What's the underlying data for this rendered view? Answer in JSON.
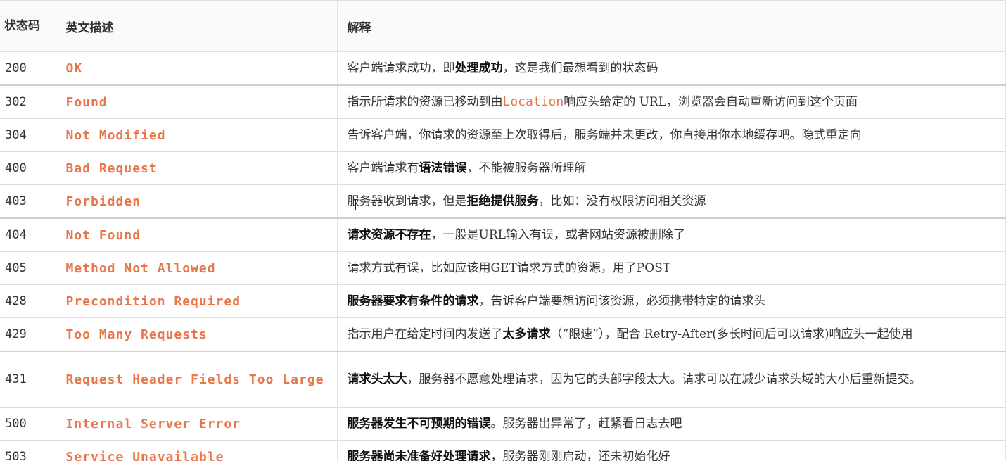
{
  "header": {
    "code": "状态码",
    "name": "英文描述",
    "desc": "解释"
  },
  "rows": [
    {
      "code": "200",
      "name": "OK",
      "desc": [
        {
          "t": "客户端请求成功，即",
          "s": "n"
        },
        {
          "t": "处理成功",
          "s": "b"
        },
        {
          "t": "，这是我们最想看到的状态码",
          "s": "n"
        }
      ]
    },
    {
      "code": "302",
      "name": "Found",
      "desc": [
        {
          "t": "指示所请求的资源已移动到由",
          "s": "n"
        },
        {
          "t": "Location",
          "s": "c"
        },
        {
          "t": "响应头给定的 URL，浏览器会自动重新访问到这个页面",
          "s": "n"
        }
      ]
    },
    {
      "code": "304",
      "name": "Not Modified",
      "desc": [
        {
          "t": "告诉客户端，你请求的资源至上次取得后，服务端并未更改，你直接用你本地缓存吧。隐式重定向",
          "s": "n"
        }
      ]
    },
    {
      "code": "400",
      "name": "Bad Request",
      "desc": [
        {
          "t": "客户端请求有",
          "s": "n"
        },
        {
          "t": "语法错误",
          "s": "b"
        },
        {
          "t": "，不能被服务器所理解",
          "s": "n"
        }
      ]
    },
    {
      "code": "403",
      "name": "Forbidden",
      "desc": [
        {
          "t": "服务器收到请求，但是",
          "s": "n"
        },
        {
          "t": "拒绝提供服务",
          "s": "b"
        },
        {
          "t": "，比如：没有权限访问相关资源",
          "s": "n"
        }
      ]
    },
    {
      "code": "404",
      "name": "Not Found",
      "desc": [
        {
          "t": "请求资源不存在",
          "s": "b"
        },
        {
          "t": "，一般是URL输入有误，或者网站资源被删除了",
          "s": "n"
        }
      ]
    },
    {
      "code": "405",
      "name": "Method Not Allowed",
      "desc": [
        {
          "t": "请求方式有误，比如应该用GET请求方式的资源，用了POST",
          "s": "n"
        }
      ]
    },
    {
      "code": "428",
      "name": "Precondition Required",
      "desc": [
        {
          "t": "服务器要求有条件的请求",
          "s": "b"
        },
        {
          "t": "，告诉客户端要想访问该资源，必须携带特定的请求头",
          "s": "n"
        }
      ]
    },
    {
      "code": "429",
      "name": "Too Many Requests",
      "desc": [
        {
          "t": "指示用户在给定时间内发送了",
          "s": "n"
        },
        {
          "t": "太多请求",
          "s": "b"
        },
        {
          "t": "（“限速”），配合 Retry-After(多长时间后可以请求)响应头一起使用",
          "s": "n"
        }
      ]
    },
    {
      "code": "431",
      "name": "Request Header Fields Too Large",
      "desc": [
        {
          "t": "请求头太大",
          "s": "b"
        },
        {
          "t": "，服务器不愿意处理请求，因为它的头部字段太大。请求可以在减少请求头域的大小后重新提交。",
          "s": "n"
        }
      ]
    },
    {
      "code": "500",
      "name": "Internal Server Error",
      "desc": [
        {
          "t": "服务器发生不可预期的错误",
          "s": "b"
        },
        {
          "t": "。服务器出异常了，赶紧看日志去吧",
          "s": "n"
        }
      ]
    },
    {
      "code": "503",
      "name": "Service Unavailable",
      "desc": [
        {
          "t": "服务器尚未准备好处理请求",
          "s": "b"
        },
        {
          "t": "，服务器刚刚启动，还未初始化好",
          "s": "n"
        }
      ]
    }
  ],
  "colors": {
    "name_accent": "#e8764a",
    "text": "#333333",
    "border": "#dddddd"
  }
}
